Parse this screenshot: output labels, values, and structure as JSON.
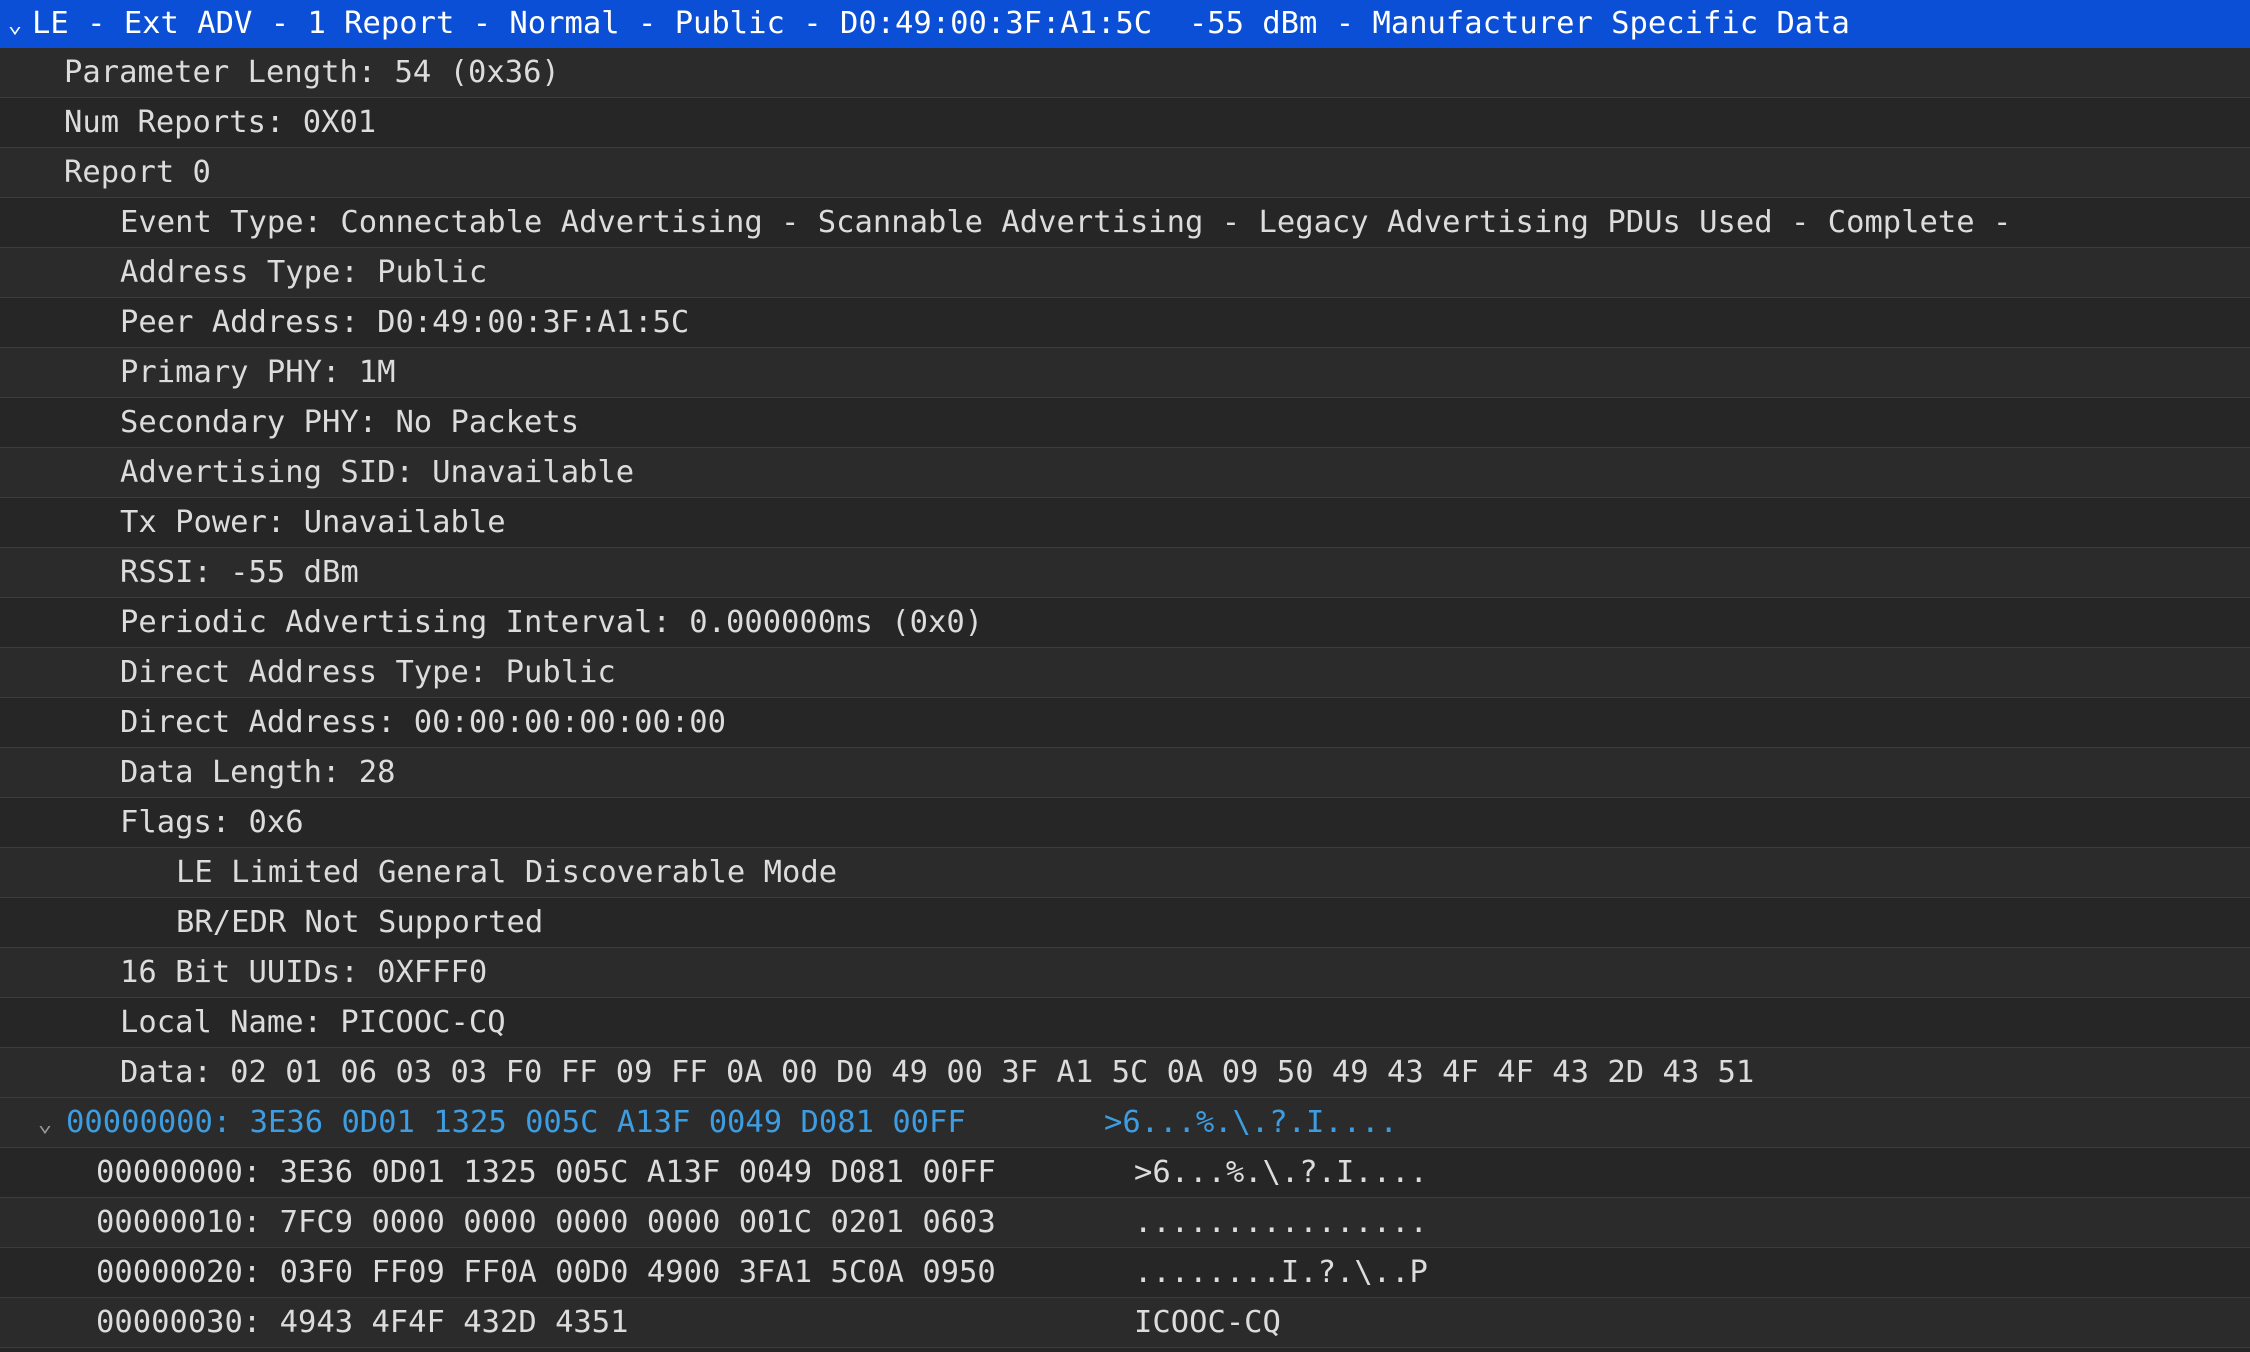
{
  "header": {
    "title": "LE - Ext ADV - 1 Report - Normal - Public - D0:49:00:3F:A1:5C  -55 dBm - Manufacturer Specific Data"
  },
  "fields": {
    "parameter_length": "Parameter Length: 54 (0x36)",
    "num_reports": "Num Reports: 0X01",
    "report": "Report 0",
    "event_type": "Event Type: Connectable Advertising - Scannable Advertising - Legacy Advertising PDUs Used - Complete -",
    "address_type": "Address Type: Public",
    "peer_address": "Peer Address: D0:49:00:3F:A1:5C",
    "primary_phy": "Primary PHY: 1M",
    "secondary_phy": "Secondary PHY: No Packets",
    "advertising_sid": "Advertising SID: Unavailable",
    "tx_power": "Tx Power: Unavailable",
    "rssi": "RSSI: -55 dBm",
    "periodic_interval": "Periodic Advertising Interval: 0.000000ms (0x0)",
    "direct_address_type": "Direct Address Type: Public",
    "direct_address": "Direct Address: 00:00:00:00:00:00",
    "data_length": "Data Length: 28",
    "flags": "Flags: 0x6",
    "flag_le_limited": "LE Limited General Discoverable Mode",
    "flag_bredr": "BR/EDR Not Supported",
    "uuids": "16 Bit UUIDs: 0XFFF0",
    "local_name": "Local Name: PICOOC-CQ",
    "data": "Data: 02 01 06 03 03 F0 FF 09 FF 0A 00 D0 49 00 3F A1 5C 0A 09 50 49 43 4F 4F 43 2D 43 51"
  },
  "hexdump": {
    "summary": {
      "hex": "00000000: 3E36 0D01 1325 005C A13F 0049 D081 00FF",
      "ascii": ">6...%.\\.?.I...."
    },
    "rows": [
      {
        "hex": "00000000: 3E36 0D01 1325 005C A13F 0049 D081 00FF",
        "ascii": ">6...%.\\.?.I...."
      },
      {
        "hex": "00000010: 7FC9 0000 0000 0000 0000 001C 0201 0603",
        "ascii": "................"
      },
      {
        "hex": "00000020: 03F0 FF09 FF0A 00D0 4900 3FA1 5C0A 0950",
        "ascii": "........I.?.\\..P"
      },
      {
        "hex": "00000030: 4943 4F4F 432D 4351",
        "ascii": "ICOOC-CQ"
      }
    ]
  },
  "icons": {
    "expand": "chevron-down-icon"
  },
  "colors": {
    "header_bg": "#0a4fd6",
    "hex_summary_text": "#3d9de0",
    "row_bg": "#2b2b2b",
    "row_alt_bg": "#262626"
  }
}
